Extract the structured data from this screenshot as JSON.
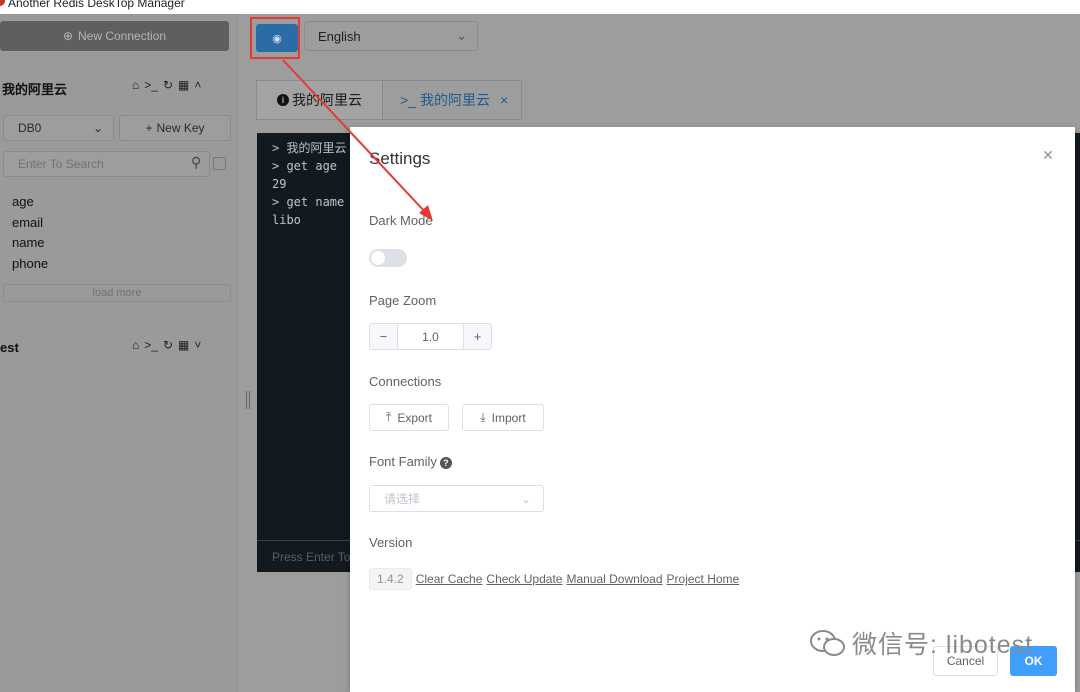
{
  "window": {
    "title": "Another Redis DeskTop Manager"
  },
  "sidebar": {
    "new_connection_label": "New Connection",
    "connections": [
      {
        "name": "我的阿里云",
        "expanded": true,
        "db_select": "DB0",
        "new_key_label": "New Key",
        "search_placeholder": "Enter To Search",
        "keys": [
          "age",
          "email",
          "name",
          "phone"
        ],
        "load_more_label": "load more"
      },
      {
        "name": "est",
        "expanded": false
      }
    ]
  },
  "topbar": {
    "language_select": "English"
  },
  "tabs": [
    {
      "label": "我的阿里云",
      "icon": "info-circle-icon"
    },
    {
      "label": "我的阿里云",
      "icon": "terminal-icon",
      "active": true
    }
  ],
  "console": {
    "lines": [
      "> 我的阿里云",
      "> get age",
      "29",
      "> get name",
      "libo"
    ],
    "placeholder": "Press Enter To"
  },
  "settings": {
    "title": "Settings",
    "dark_mode_label": "Dark Mode",
    "dark_mode_on": false,
    "page_zoom_label": "Page Zoom",
    "zoom_value": "1.0",
    "zoom_dec": "−",
    "zoom_inc": "+",
    "connections_label": "Connections",
    "export_label": "Export",
    "import_label": "Import",
    "font_family_label": "Font Family",
    "font_placeholder": "请选择",
    "version_label": "Version",
    "version": "1.4.2",
    "links": [
      "Clear Cache",
      "Check Update",
      "Manual Download",
      "Project Home"
    ],
    "cancel_label": "Cancel",
    "ok_label": "OK"
  },
  "watermark": {
    "text": "微信号: libotest"
  },
  "colors": {
    "primary": "#409eff",
    "annotation": "#e53935",
    "settings_button": "#2b6ca6"
  }
}
